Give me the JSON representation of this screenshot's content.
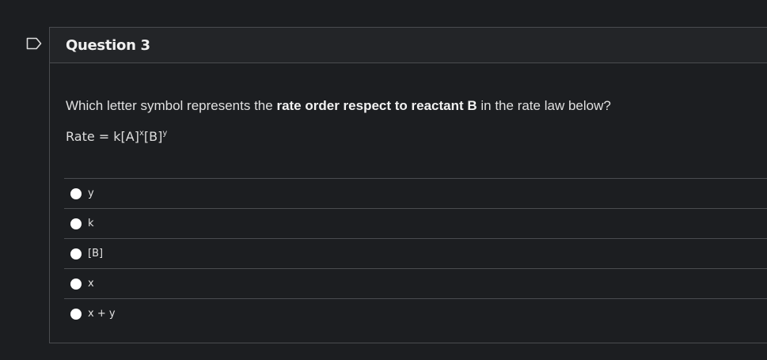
{
  "question": {
    "title": "Question 3",
    "prompt": {
      "before": "Which letter symbol represents the ",
      "bold": "rate order respect to reactant B",
      "after": " in the rate law below?"
    },
    "equation": {
      "prefix": "Rate = k[A]",
      "exp_a": "x",
      "middle": "[B]",
      "exp_b": "y"
    },
    "answers": [
      {
        "label": "y"
      },
      {
        "label": "k"
      },
      {
        "label": "[B]"
      },
      {
        "label": "x"
      },
      {
        "label": "x + y"
      }
    ]
  },
  "colors": {
    "background": "#1c1e21",
    "border": "#4a4c50",
    "radio": "#ffffff"
  },
  "icons": {
    "flag": "flag-icon"
  }
}
